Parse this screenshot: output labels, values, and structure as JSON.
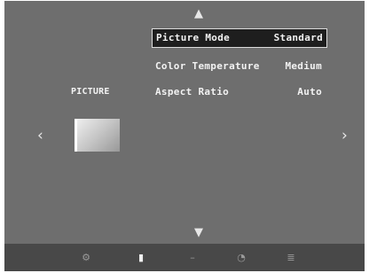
{
  "menu": {
    "category": "PICTURE",
    "items": [
      {
        "label": "Picture Mode",
        "value": "Standard",
        "selected": true
      },
      {
        "label": "Color Temperature",
        "value": "Medium",
        "selected": false
      },
      {
        "label": "Aspect Ratio",
        "value": "Auto",
        "selected": false
      }
    ]
  },
  "nav": {
    "up": "▲",
    "down": "▼",
    "left": "‹",
    "right": "›"
  },
  "toolbar": {
    "icons": [
      {
        "name": "settings-icon",
        "glyph": "⚙",
        "active": false
      },
      {
        "name": "picture-icon",
        "glyph": "▮",
        "active": true
      },
      {
        "name": "sound-icon",
        "glyph": "–",
        "active": false
      },
      {
        "name": "timer-icon",
        "glyph": "◔",
        "active": false
      },
      {
        "name": "setup-icon",
        "glyph": "≣",
        "active": false
      }
    ]
  },
  "colors": {
    "screen_bg": "#6e6e6e",
    "bar_bg": "#484848",
    "highlight_bg": "#1e1e1e",
    "text": "#f2f2f2"
  }
}
